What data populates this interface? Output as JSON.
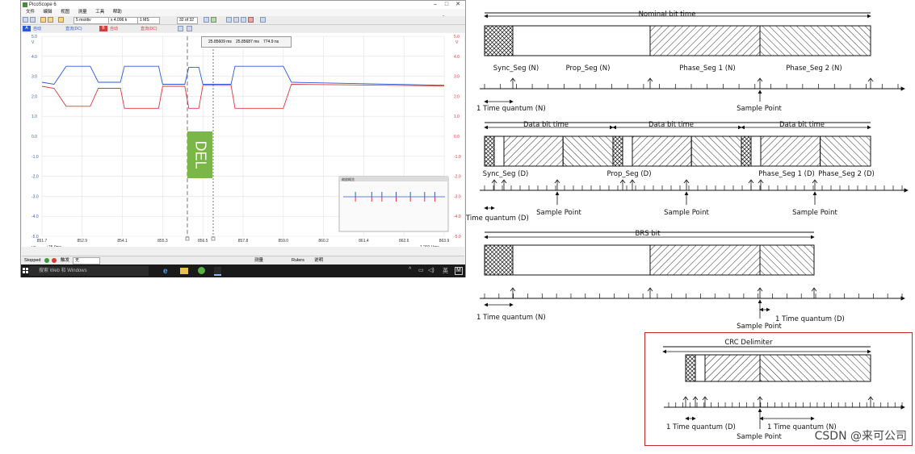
{
  "window": {
    "title": "PicoScope 6",
    "menu": [
      "文件",
      "编辑",
      "视图",
      "测量",
      "工具",
      "帮助"
    ],
    "logo": "pico"
  },
  "toolbar": {
    "timebase": "5 ms/div",
    "zoom": "x 4.096 k",
    "samples": "1 MS",
    "buffer": "32 of 32"
  },
  "channels": [
    {
      "label": "A",
      "coupling": "自动",
      "range": "直流(DC)",
      "color": "#2a5ad8"
    },
    {
      "label": "B",
      "coupling": "自动",
      "range": "直流(DC)",
      "color": "#d83a3a"
    }
  ],
  "rulers": {
    "readout": [
      "25.85609 ms",
      "25.85687 ms",
      "774.9 ns"
    ]
  },
  "scope": {
    "left_axis_unit": "V",
    "right_axis_unit": "V",
    "left_ticks": [
      "5.0",
      "4.0",
      "3.0",
      "2.0",
      "1.0",
      "0.0",
      "-1.0",
      "-2.0",
      "-3.0",
      "-4.0",
      "-5.0"
    ],
    "right_ticks": [
      "5.0",
      "4.0",
      "3.0",
      "2.0",
      "1.0",
      "0.0",
      "-1.0",
      "-2.0",
      "-3.0",
      "-4.0",
      "-5.0"
    ],
    "x_ticks": [
      "851.7",
      "852.9",
      "854.1",
      "855.3",
      "856.5",
      "857.8",
      "859.0",
      "860.2",
      "861.4",
      "862.6",
      "863.9"
    ],
    "x_unit": "µs",
    "x_offset": "+25.0ms",
    "scale_readout": "1.291 Vms",
    "del_marker": "DEL",
    "overview_title": "缩放概览"
  },
  "status": {
    "state": "Stopped",
    "trigger_label": "触发",
    "trigger_value": "无",
    "measure_label": "测量",
    "rulers_label": "Rulers",
    "notes_label": "说明"
  },
  "taskbar": {
    "search_placeholder": "搜索 Web 和 Windows",
    "lang": "英"
  },
  "diagram": {
    "nominal_title": "Nominal bit time",
    "nominal_segments": [
      "Sync_Seg (N)",
      "Prop_Seg (N)",
      "Phase_Seg 1 (N)",
      "Phase_Seg 2 (N)"
    ],
    "nominal_tq": "1 Time quantum (N)",
    "nominal_sample": "Sample Point",
    "data_titles": [
      "Data bit time",
      "Data bit time",
      "Data bit time"
    ],
    "data_segments": [
      "Sync_Seg (D)",
      "Prop_Seg (D)",
      "Phase_Seg 1 (D)",
      "Phase_Seg 2 (D)"
    ],
    "data_tq": "Time quantum (D)",
    "data_samples": [
      "Sample Point",
      "Sample Point",
      "Sample Point"
    ],
    "brs_title": "BRS bit",
    "brs_tq_n": "1 Time quantum (N)",
    "brs_sample": "Sample Point",
    "brs_tq_d": "1 Time quantum (D)",
    "crc_title": "CRC Delimiter",
    "crc_tq_d": "1 Time quantum (D)",
    "crc_tq_n": "1 Time quantum (N)",
    "crc_sample": "Sample Point"
  },
  "watermark": "CSDN @来可公司"
}
